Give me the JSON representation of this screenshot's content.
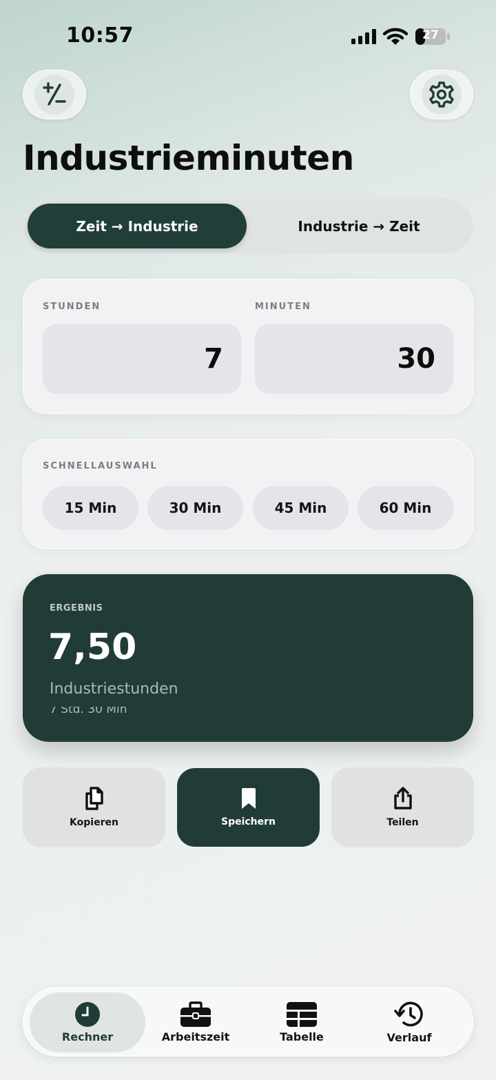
{
  "status_bar": {
    "time": "10:57",
    "battery_level": "27",
    "icons": [
      "cellular-signal-icon",
      "wifi-icon",
      "battery-icon"
    ]
  },
  "header": {
    "left_button_icon": "plus-minus-icon",
    "right_button_icon": "gear-icon",
    "title": "Industrieminuten"
  },
  "mode_toggle": {
    "options": [
      "Zeit → Industrie",
      "Industrie → Zeit"
    ],
    "selected": "Zeit → Industrie"
  },
  "inputs": {
    "hours_label": "STUNDEN",
    "hours_value": "7",
    "minutes_label": "MINUTEN",
    "minutes_value": "30"
  },
  "quick_select": {
    "label": "SCHNELLAUSWAHL",
    "options": [
      "15 Min",
      "30 Min",
      "45 Min",
      "60 Min"
    ]
  },
  "result": {
    "label": "ERGEBNIS",
    "value": "7,50",
    "unit": "Industriestunden",
    "detail": "7 Std. 30 Min"
  },
  "actions": [
    {
      "label": "Kopieren",
      "icon": "copy-icon"
    },
    {
      "label": "Speichern",
      "icon": "bookmark-icon"
    },
    {
      "label": "Teilen",
      "icon": "share-icon"
    }
  ],
  "tab_bar": {
    "items": [
      {
        "label": "Rechner",
        "icon": "clock-icon"
      },
      {
        "label": "Arbeitszeit",
        "icon": "briefcase-icon"
      },
      {
        "label": "Tabelle",
        "icon": "table-icon"
      },
      {
        "label": "Verlauf",
        "icon": "history-icon"
      }
    ],
    "selected": "Rechner"
  },
  "colors": {
    "accent_dark_green": "#213c37",
    "card_background": "#f2f2f5",
    "input_background": "#e4e4e9"
  }
}
